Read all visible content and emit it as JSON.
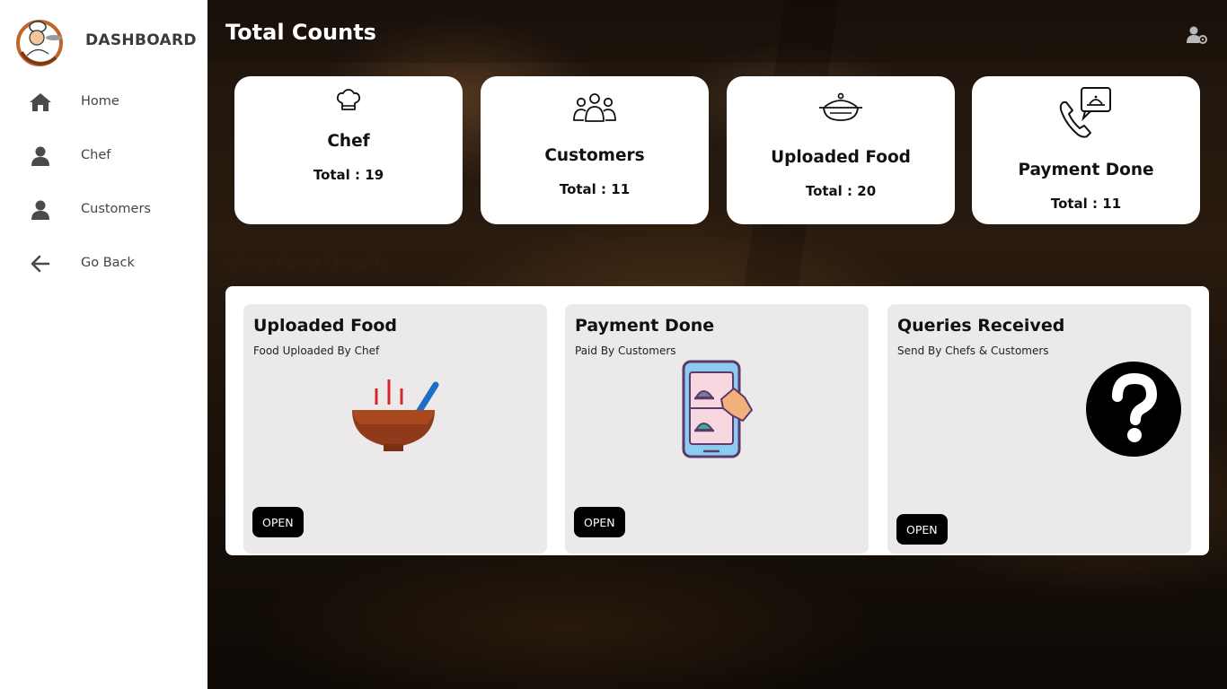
{
  "sidebar": {
    "brand": "DASHBOARD",
    "items": [
      {
        "label": "Home",
        "icon": "home-icon"
      },
      {
        "label": "Chef",
        "icon": "user-icon"
      },
      {
        "label": "Customers",
        "icon": "user-icon"
      },
      {
        "label": "Go Back",
        "icon": "arrow-left-icon"
      }
    ]
  },
  "header": {
    "title": "Total Counts",
    "settings_icon": "user-settings-icon"
  },
  "stats": [
    {
      "title": "Chef",
      "total": "Total : 19",
      "icon": "chef-hat-icon"
    },
    {
      "title": "Customers",
      "total": "Total : 11",
      "icon": "group-icon"
    },
    {
      "title": "Uploaded Food",
      "total": "Total : 20",
      "icon": "cooking-pot-icon"
    },
    {
      "title": "Payment Done",
      "total": "Total : 11",
      "icon": "phone-order-icon"
    }
  ],
  "details": {
    "section_title": "View Food Details",
    "cards": [
      {
        "title": "Uploaded Food",
        "subtitle": "Food Uploaded By Chef",
        "button": "OPEN",
        "image": "soup-bowl-icon"
      },
      {
        "title": "Payment Done",
        "subtitle": "Paid By Customers",
        "button": "OPEN",
        "image": "mobile-order-icon"
      },
      {
        "title": "Queries Received",
        "subtitle": "Send By Chefs & Customers",
        "button": "OPEN",
        "image": "question-icon"
      }
    ]
  },
  "colors": {
    "sidebar_bg": "#ffffff",
    "card_bg": "#ffffff",
    "detail_card_bg": "#ebe9ea",
    "button_bg": "#000000",
    "title_text": "#ffffff"
  }
}
